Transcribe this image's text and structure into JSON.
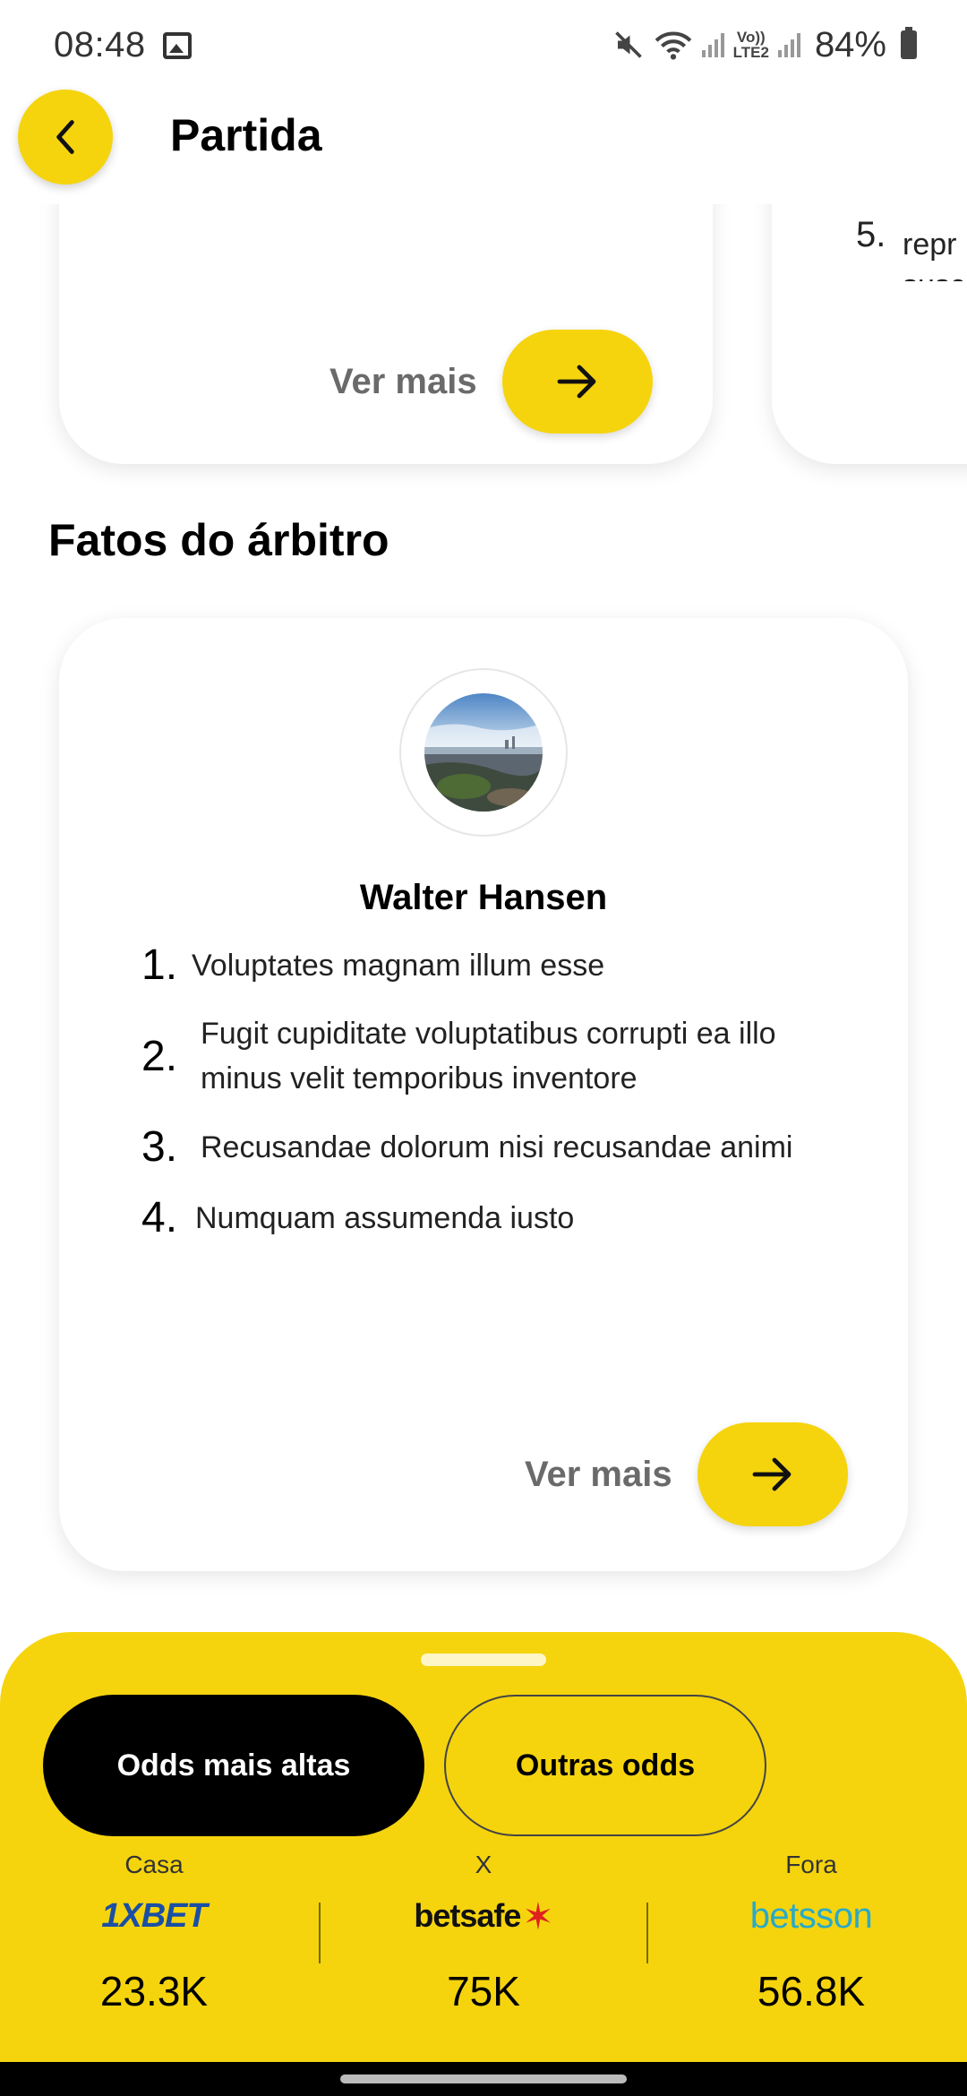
{
  "status_bar": {
    "time": "08:48",
    "net_label_top": "Vo))",
    "net_label_bottom": "LTE2",
    "battery": "84%"
  },
  "header": {
    "title": "Partida",
    "back_icon": "chevron-left-icon"
  },
  "previous_card": {
    "peek_number": "5.",
    "peek_text_line1": "repr",
    "peek_text_line2": "susc",
    "ver_mais_label": "Ver mais"
  },
  "referee_section": {
    "title": "Fatos do árbitro",
    "name": "Walter Hansen",
    "facts": [
      {
        "num": "1.",
        "text": "Voluptates magnam illum esse"
      },
      {
        "num": "2.",
        "text": "Fugit cupiditate voluptatibus corrupti ea illo minus velit temporibus inventore"
      },
      {
        "num": "3.",
        "text": "Recusandae dolorum nisi recusandae animi"
      },
      {
        "num": "4.",
        "text": "Numquam assumenda iusto"
      }
    ],
    "ver_mais_label": "Ver mais"
  },
  "odds_sheet": {
    "tabs": [
      {
        "label": "Odds mais altas",
        "active": true
      },
      {
        "label": "Outras odds",
        "active": false
      }
    ],
    "columns": [
      {
        "label": "Casa",
        "bookmaker": "1XBET",
        "value": "23.3K"
      },
      {
        "label": "X",
        "bookmaker": "betsafe",
        "value": "75K"
      },
      {
        "label": "Fora",
        "bookmaker": "betsson",
        "value": "56.8K"
      }
    ]
  },
  "colors": {
    "accent_yellow": "#f5d40e",
    "active_tab": "#000000",
    "text_muted": "#6a6a6a"
  }
}
